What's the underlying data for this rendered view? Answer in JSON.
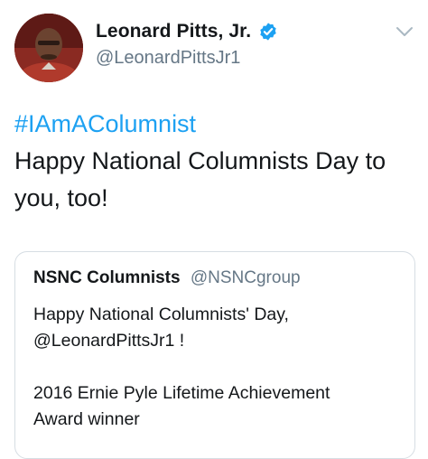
{
  "tweet": {
    "author": {
      "display_name": "Leonard Pitts, Jr.",
      "handle": "@LeonardPittsJr1",
      "verified": true,
      "avatar_icon": "profile-photo"
    },
    "hashtag": "#IAmAColumnist",
    "text": "Happy National Columnists Day to you, too!",
    "menu_icon": "chevron-down-icon"
  },
  "quoted_tweet": {
    "display_name": "NSNC Columnists",
    "handle": "@NSNCgroup",
    "line1": "Happy National Columnists' Day,",
    "line2": "@LeonardPittsJr1 !",
    "line3": "2016 Ernie Pyle Lifetime Achievement",
    "line4": "Award winner"
  },
  "colors": {
    "link": "#1da1f2",
    "secondary_text": "#657786",
    "primary_text": "#14171a",
    "card_border": "#d6dde3"
  }
}
